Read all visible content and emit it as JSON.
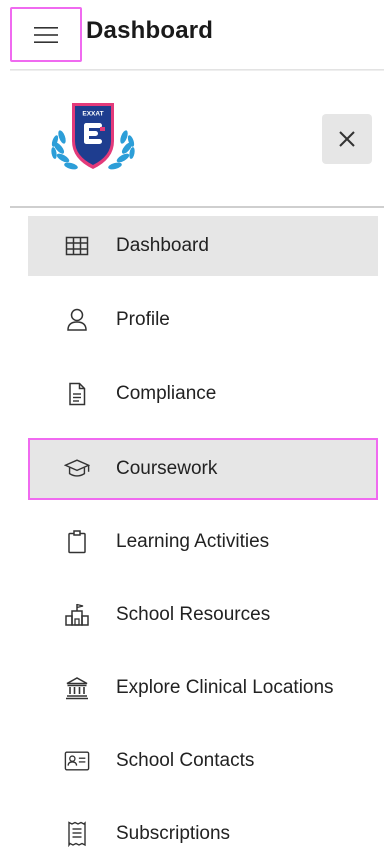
{
  "header": {
    "title": "Dashboard",
    "menu_icon": "hamburger-menu-icon",
    "highlight_color": "#f06af0"
  },
  "drawer": {
    "logo_text": "EXXAT",
    "close_icon": "close-icon",
    "items": [
      {
        "label": "Dashboard",
        "icon": "grid-icon",
        "active": true
      },
      {
        "label": "Profile",
        "icon": "user-icon"
      },
      {
        "label": "Compliance",
        "icon": "document-icon"
      },
      {
        "label": "Coursework",
        "icon": "graduation-cap-icon",
        "highlighted": true
      },
      {
        "label": "Learning Activities",
        "icon": "clipboard-icon"
      },
      {
        "label": "School Resources",
        "icon": "school-icon"
      },
      {
        "label": "Explore Clinical Locations",
        "icon": "institution-icon"
      },
      {
        "label": "School Contacts",
        "icon": "contact-card-icon"
      },
      {
        "label": "Subscriptions",
        "icon": "receipt-icon"
      }
    ]
  }
}
